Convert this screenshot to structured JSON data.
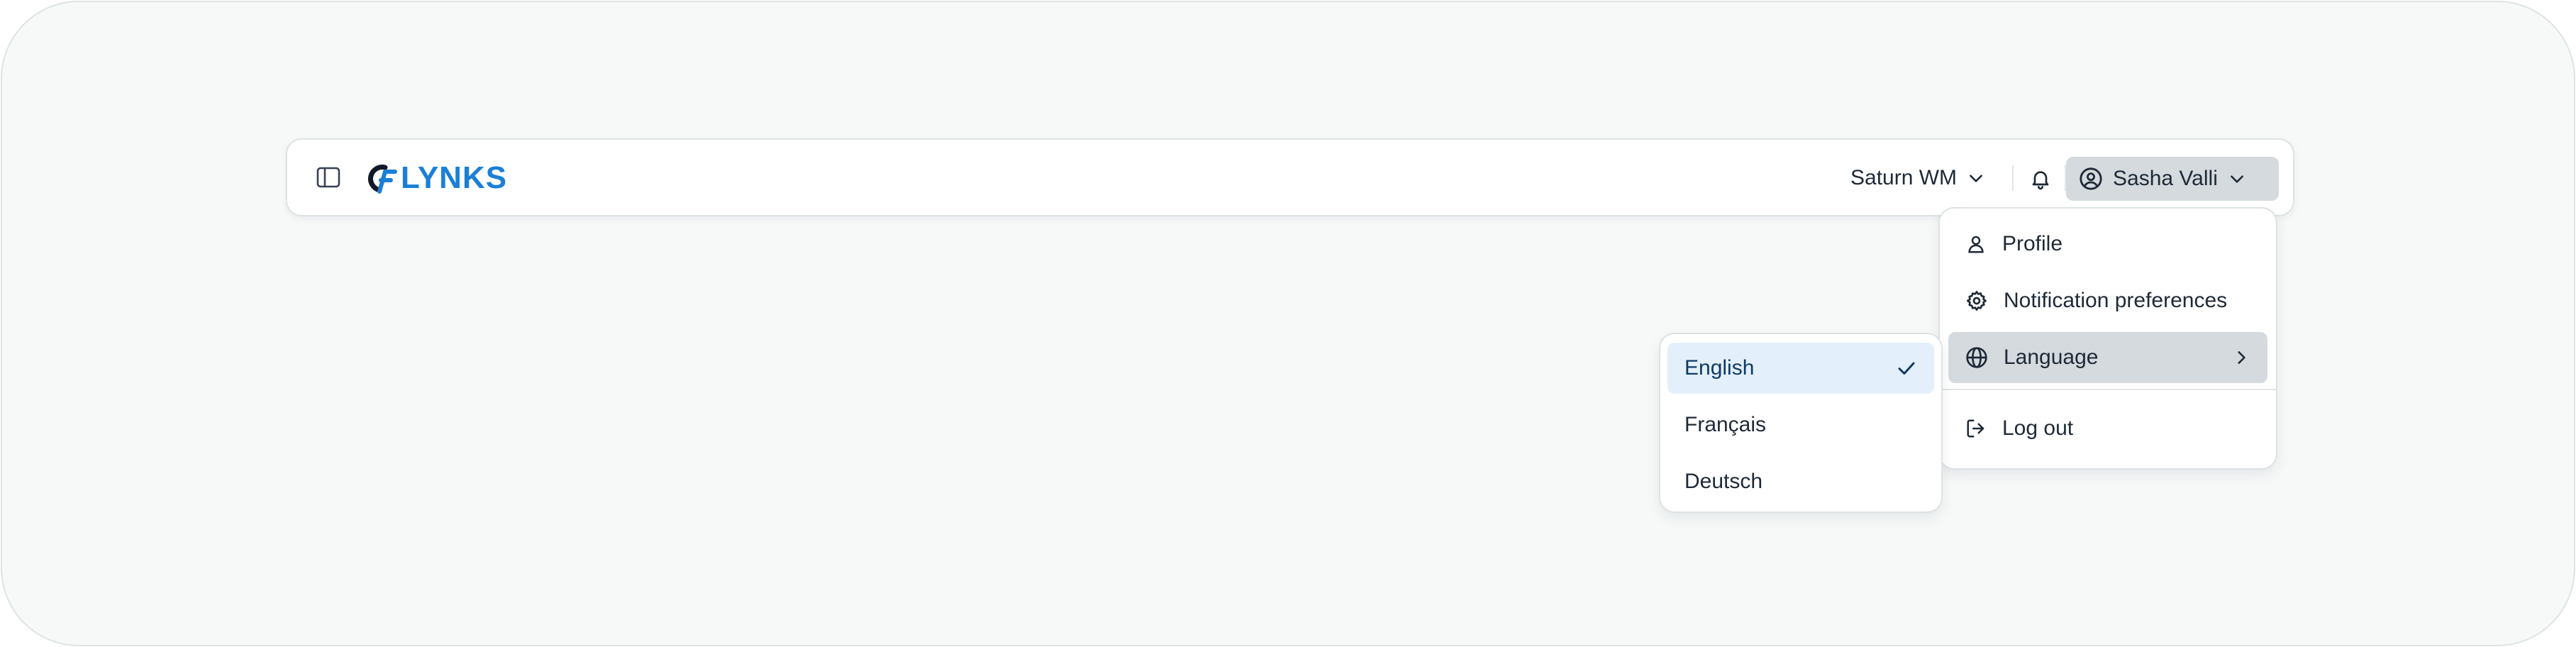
{
  "brand": {
    "name": "LYNKS",
    "accent": "#1b7fd6"
  },
  "header": {
    "org_name": "Saturn WM",
    "user_name": "Sasha Valli"
  },
  "user_dropdown": {
    "items": [
      {
        "label": "Profile",
        "icon": "user-icon"
      },
      {
        "label": "Notification preferences",
        "icon": "gear-icon"
      },
      {
        "label": "Language",
        "icon": "globe-icon",
        "has_submenu": true
      },
      {
        "label": "Log out",
        "icon": "logout-icon"
      }
    ]
  },
  "language_submenu": {
    "selected": "English",
    "options": [
      "English",
      "Français",
      "Deutsch"
    ]
  },
  "colors": {
    "background": "#f7f9f9",
    "active_item": "#d4dadd",
    "selected_language": "#e3f0fb"
  }
}
